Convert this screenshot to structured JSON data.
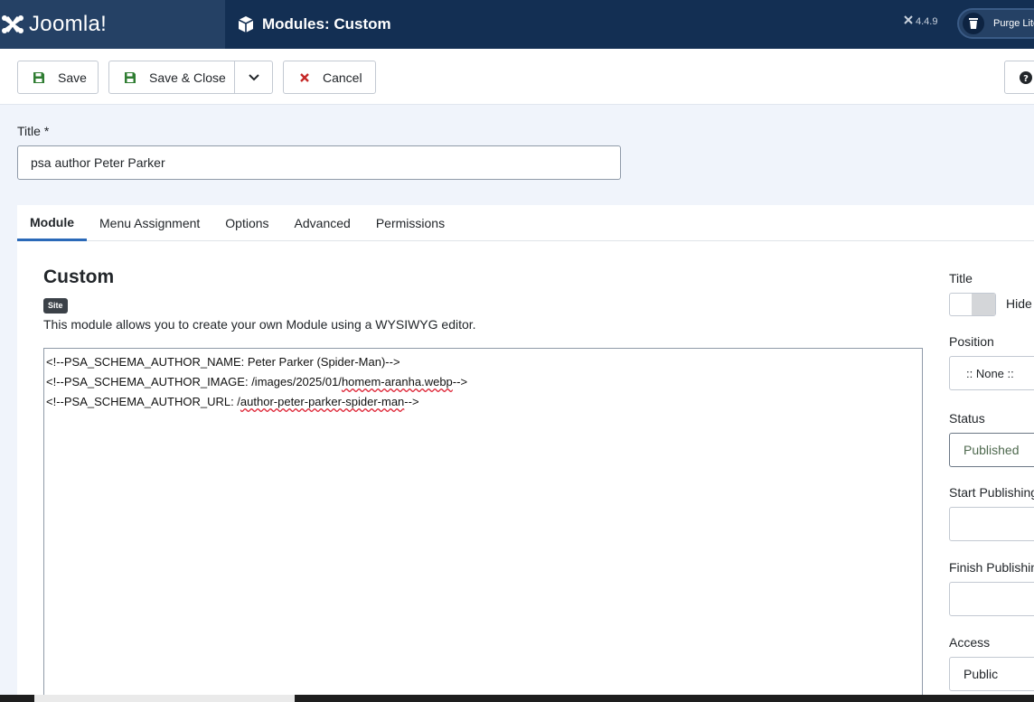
{
  "app": {
    "logo_text": "Joomla!",
    "page_title": "Modules: Custom",
    "version": "4.4.9",
    "purge_label": "Purge Lite"
  },
  "toolbar": {
    "save_label": "Save",
    "save_close_label": "Save & Close",
    "cancel_label": "Cancel"
  },
  "form": {
    "title_label": "Title *",
    "title_value": "psa author Peter Parker"
  },
  "tabs": [
    {
      "label": "Module",
      "active": true
    },
    {
      "label": "Menu Assignment",
      "active": false
    },
    {
      "label": "Options",
      "active": false
    },
    {
      "label": "Advanced",
      "active": false
    },
    {
      "label": "Permissions",
      "active": false
    }
  ],
  "module": {
    "heading": "Custom",
    "badge": "Site",
    "description": "This module allows you to create your own Module using a WYSIWYG editor.",
    "editor_lines": [
      "<!--PSA_SCHEMA_AUTHOR_NAME: Peter Parker (Spider-Man)-->",
      "<!--PSA_SCHEMA_AUTHOR_IMAGE: /images/2025/01/homem-aranha.webp-->",
      "<!--PSA_SCHEMA_AUTHOR_URL: /author-peter-parker-spider-man-->"
    ]
  },
  "sidebar": {
    "title_label": "Title",
    "hide_label": "Hide",
    "position_label": "Position",
    "position_value": ":: None ::",
    "status_label": "Status",
    "status_value": "Published",
    "start_publishing_label": "Start Publishing",
    "finish_publishing_label": "Finish Publishing",
    "access_label": "Access",
    "access_value": "Public"
  },
  "colors": {
    "header_bg": "#132f53",
    "logo_bg": "#254165",
    "accent": "#2a69b8",
    "save_icon": "#2f7d32",
    "cancel_icon": "#c52827"
  }
}
